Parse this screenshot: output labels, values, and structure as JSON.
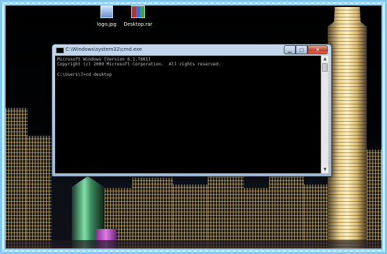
{
  "desktop": {
    "icons": [
      {
        "label": "logo.jpg",
        "icon": "image-file-icon"
      },
      {
        "label": "Desktop.rar",
        "icon": "archive-file-icon"
      }
    ]
  },
  "window": {
    "title": "C:\\Windows\\system32\\cmd.exe",
    "buttons": {
      "minimize": "minimize-icon",
      "maximize": "maximize-icon",
      "close": "close-icon"
    },
    "console_lines": [
      "Microsoft Windows [Version 6.1.7601]",
      "Copyright (c) 2009 Microsoft Corporation.  All rights reserved.",
      "",
      "C:\\Users\\7>cd desktop"
    ]
  }
}
